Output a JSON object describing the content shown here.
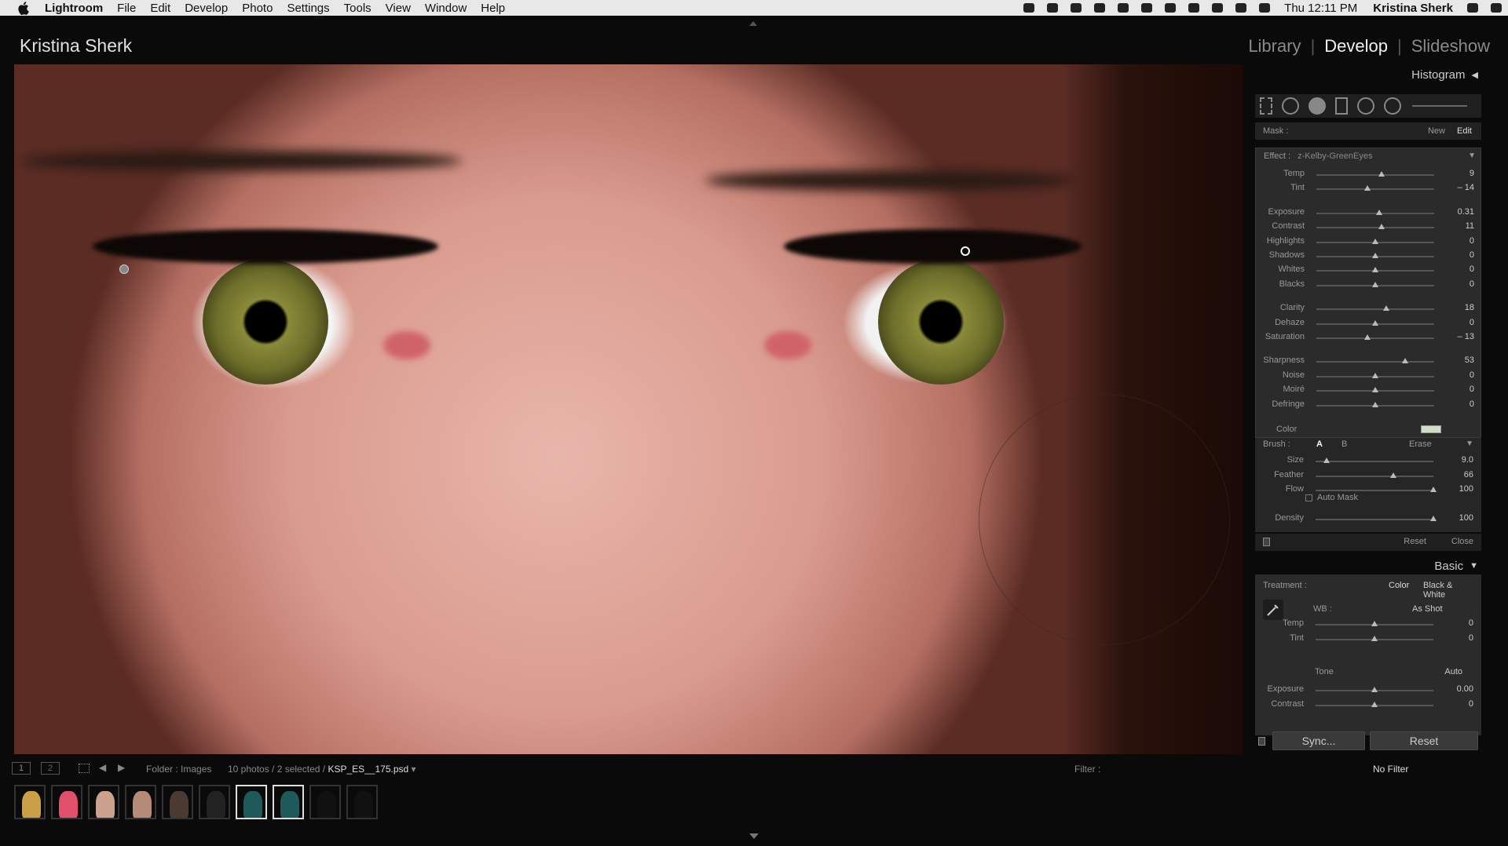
{
  "menubar": {
    "app": "Lightroom",
    "items": [
      "File",
      "Edit",
      "Develop",
      "Photo",
      "Settings",
      "Tools",
      "View",
      "Window",
      "Help"
    ],
    "clock": "Thu 12:11 PM",
    "user": "Kristina Sherk"
  },
  "identity_plate": "Kristina Sherk",
  "modules": [
    "Library",
    "Develop",
    "Slideshow"
  ],
  "active_module": "Develop",
  "panel": {
    "histogram_label": "Histogram",
    "mask": {
      "label": "Mask :",
      "new": "New",
      "edit": "Edit"
    },
    "effect": {
      "label": "Effect :",
      "preset": "z-Kelby-GreenEyes",
      "sliders": [
        {
          "label": "Temp",
          "value": "9",
          "pos": 0.55
        },
        {
          "label": "Tint",
          "value": "– 14",
          "pos": 0.43
        },
        {
          "label": "Exposure",
          "value": "0.31",
          "pos": 0.53
        },
        {
          "label": "Contrast",
          "value": "11",
          "pos": 0.55
        },
        {
          "label": "Highlights",
          "value": "0",
          "pos": 0.5
        },
        {
          "label": "Shadows",
          "value": "0",
          "pos": 0.5
        },
        {
          "label": "Whites",
          "value": "0",
          "pos": 0.5
        },
        {
          "label": "Blacks",
          "value": "0",
          "pos": 0.5
        },
        {
          "label": "Clarity",
          "value": "18",
          "pos": 0.59
        },
        {
          "label": "Dehaze",
          "value": "0",
          "pos": 0.5
        },
        {
          "label": "Saturation",
          "value": "– 13",
          "pos": 0.43
        },
        {
          "label": "Sharpness",
          "value": "53",
          "pos": 0.75
        },
        {
          "label": "Noise",
          "value": "0",
          "pos": 0.5
        },
        {
          "label": "Moiré",
          "value": "0",
          "pos": 0.5
        },
        {
          "label": "Defringe",
          "value": "0",
          "pos": 0.5
        }
      ],
      "color_label": "Color",
      "color_swatch": "#cfe0c6"
    },
    "brush": {
      "label": "Brush :",
      "a": "A",
      "b": "B",
      "erase": "Erase",
      "sliders": [
        {
          "label": "Size",
          "value": "9.0",
          "pos": 0.09
        },
        {
          "label": "Feather",
          "value": "66",
          "pos": 0.66
        },
        {
          "label": "Flow",
          "value": "100",
          "pos": 1.0
        }
      ],
      "auto_mask": "Auto Mask",
      "density": {
        "label": "Density",
        "value": "100",
        "pos": 1.0
      },
      "reset": "Reset",
      "close": "Close"
    },
    "basic": {
      "label": "Basic",
      "treatment_label": "Treatment :",
      "color": "Color",
      "bw": "Black & White",
      "wb_label": "WB :",
      "wb_value": "As Shot",
      "sliders": [
        {
          "label": "Temp",
          "value": "0",
          "pos": 0.5
        },
        {
          "label": "Tint",
          "value": "0",
          "pos": 0.5
        }
      ],
      "tone": "Tone",
      "auto": "Auto",
      "tone_sliders": [
        {
          "label": "Exposure",
          "value": "0.00",
          "pos": 0.5
        },
        {
          "label": "Contrast",
          "value": "0",
          "pos": 0.5
        }
      ]
    },
    "sync": "Sync...",
    "reset": "Reset"
  },
  "filmstrip_bar": {
    "page1": "1",
    "page2": "2",
    "folder": "Folder : Images",
    "count": "10 photos / 2 selected /",
    "filename": "KSP_ES__175.psd",
    "filter_label": "Filter :",
    "filter_value": "No Filter"
  },
  "thumbnails": [
    {
      "color": "#c9a048",
      "sel": false
    },
    {
      "color": "#e0506a",
      "sel": false
    },
    {
      "color": "#caa18c",
      "sel": false
    },
    {
      "color": "#b58a77",
      "sel": false
    },
    {
      "color": "#4a3a32",
      "sel": false
    },
    {
      "color": "#222222",
      "sel": false
    },
    {
      "color": "#1f5a5a",
      "sel": true
    },
    {
      "color": "#1f5a5a",
      "sel": true
    },
    {
      "color": "#111111",
      "sel": false
    },
    {
      "color": "#111111",
      "sel": false
    }
  ]
}
